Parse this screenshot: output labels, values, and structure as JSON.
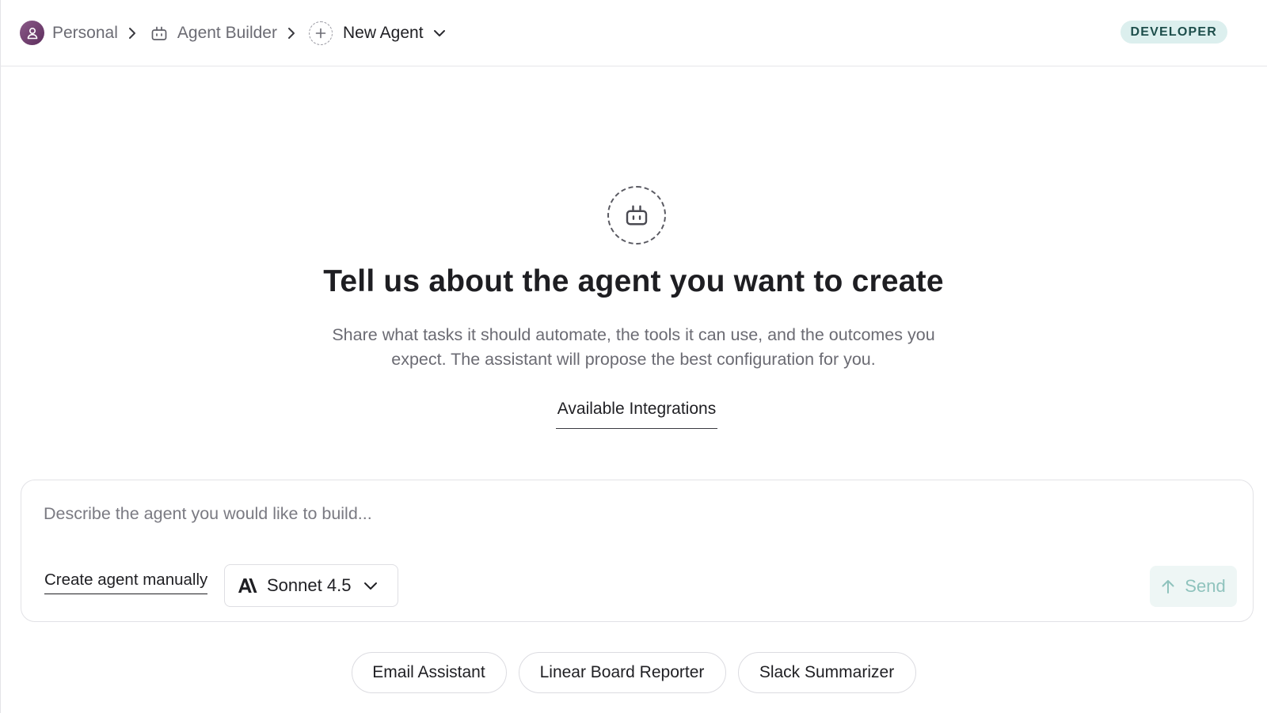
{
  "header": {
    "breadcrumb": {
      "workspace": "Personal",
      "section": "Agent Builder",
      "current": "New Agent"
    },
    "badge": "DEVELOPER"
  },
  "hero": {
    "title": "Tell us about the agent you want to create",
    "subtitle": "Share what tasks it should automate, the tools it can use, and the outcomes you expect. The assistant will propose the best configuration for you.",
    "integrations_link": "Available Integrations"
  },
  "composer": {
    "placeholder": "Describe the agent you would like to build...",
    "manual_link": "Create agent manually",
    "model": "Sonnet 4.5",
    "send_label": "Send"
  },
  "suggestions": [
    "Email Assistant",
    "Linear Board Reporter",
    "Slack Summarizer"
  ],
  "colors": {
    "badge_bg": "#dcefee",
    "badge_text": "#1d4e4b",
    "avatar": "#6e3b6c",
    "send_accent": "#8fc3bd"
  },
  "icons": {
    "avatar": "user-icon",
    "section": "robot-icon",
    "new": "plus-icon",
    "hero": "robot-icon",
    "model": "anthropic-logo-icon",
    "send": "arrow-up-icon"
  }
}
